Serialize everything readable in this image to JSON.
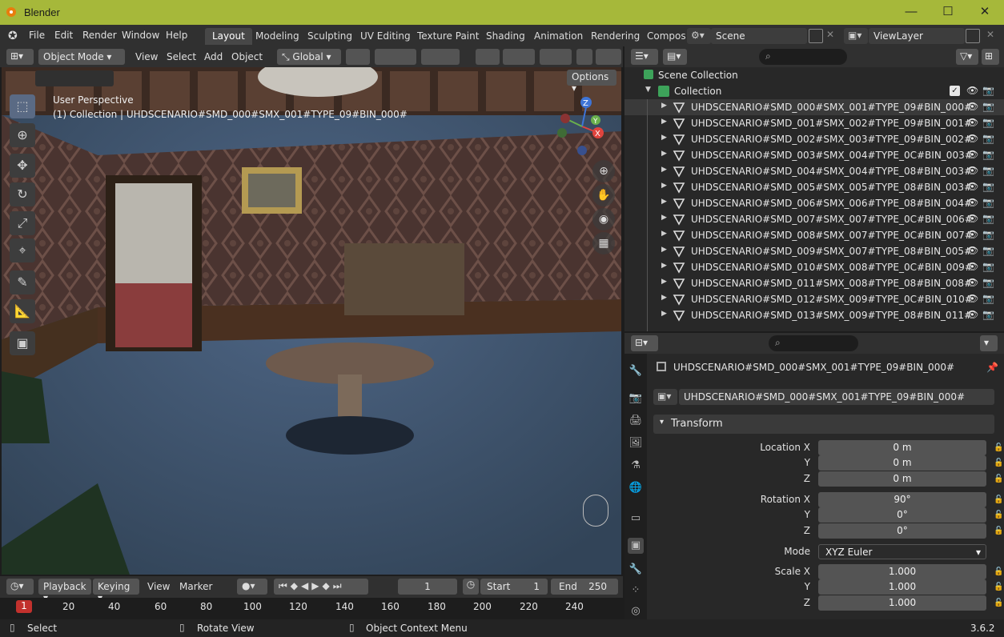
{
  "window": {
    "title": "Blender",
    "minimize": "—",
    "maximize": "☐",
    "close": "✕"
  },
  "menubar": {
    "menus": [
      "File",
      "Edit",
      "Render",
      "Window",
      "Help"
    ],
    "workspaces": [
      "Layout",
      "Modeling",
      "Sculpting",
      "UV Editing",
      "Texture Paint",
      "Shading",
      "Animation",
      "Rendering",
      "Compos"
    ],
    "active_workspace": "Layout",
    "scene": "Scene",
    "view_layer": "ViewLayer"
  },
  "viewport_header": {
    "mode": "Object Mode",
    "menus": [
      "View",
      "Select",
      "Add",
      "Object"
    ],
    "orientation": "Global"
  },
  "viewport": {
    "options_label": "Options",
    "perspective": "User Perspective",
    "active_info": "(1) Collection | UHDSCENARIO#SMD_000#SMX_001#TYPE_09#BIN_000#",
    "gizmo": {
      "x": "X",
      "y": "Y",
      "z": "Z"
    },
    "colors": {
      "x": "#e0443e",
      "y": "#6ab04c",
      "z": "#3e74d6"
    }
  },
  "timeline": {
    "playback": "Playback",
    "keying": "Keying",
    "view": "View",
    "marker": "Marker",
    "current_frame": "1",
    "start_label": "Start",
    "start": "1",
    "end_label": "End",
    "end": "250",
    "ruler": [
      "1",
      "20",
      "40",
      "60",
      "80",
      "100",
      "120",
      "140",
      "160",
      "180",
      "200",
      "220",
      "240"
    ]
  },
  "statusbar": {
    "select": "Select",
    "rotate": "Rotate View",
    "context": "Object Context Menu",
    "version": "3.6.2"
  },
  "outliner": {
    "scene_collection": "Scene Collection",
    "collection": "Collection",
    "objects": [
      "UHDSCENARIO#SMD_000#SMX_001#TYPE_09#BIN_000#",
      "UHDSCENARIO#SMD_001#SMX_002#TYPE_09#BIN_001#",
      "UHDSCENARIO#SMD_002#SMX_003#TYPE_09#BIN_002#",
      "UHDSCENARIO#SMD_003#SMX_004#TYPE_0C#BIN_003#",
      "UHDSCENARIO#SMD_004#SMX_004#TYPE_08#BIN_003#",
      "UHDSCENARIO#SMD_005#SMX_005#TYPE_08#BIN_003#",
      "UHDSCENARIO#SMD_006#SMX_006#TYPE_08#BIN_004#",
      "UHDSCENARIO#SMD_007#SMX_007#TYPE_0C#BIN_006#",
      "UHDSCENARIO#SMD_008#SMX_007#TYPE_0C#BIN_007#",
      "UHDSCENARIO#SMD_009#SMX_007#TYPE_08#BIN_005#",
      "UHDSCENARIO#SMD_010#SMX_008#TYPE_0C#BIN_009#",
      "UHDSCENARIO#SMD_011#SMX_008#TYPE_08#BIN_008#",
      "UHDSCENARIO#SMD_012#SMX_009#TYPE_0C#BIN_010#",
      "UHDSCENARIO#SMD_013#SMX_009#TYPE_08#BIN_011#"
    ]
  },
  "properties": {
    "object_name": "UHDSCENARIO#SMD_000#SMX_001#TYPE_09#BIN_000#",
    "name_field": "UHDSCENARIO#SMD_000#SMX_001#TYPE_09#BIN_000#",
    "panel": "Transform",
    "location_label": "Location X",
    "rotation_label": "Rotation X",
    "scale_label": "Scale X",
    "y_label": "Y",
    "z_label": "Z",
    "mode_label": "Mode",
    "mode": "XYZ Euler",
    "location": [
      "0 m",
      "0 m",
      "0 m"
    ],
    "rotation": [
      "90°",
      "0°",
      "0°"
    ],
    "scale": [
      "1.000",
      "1.000",
      "1.000"
    ]
  }
}
